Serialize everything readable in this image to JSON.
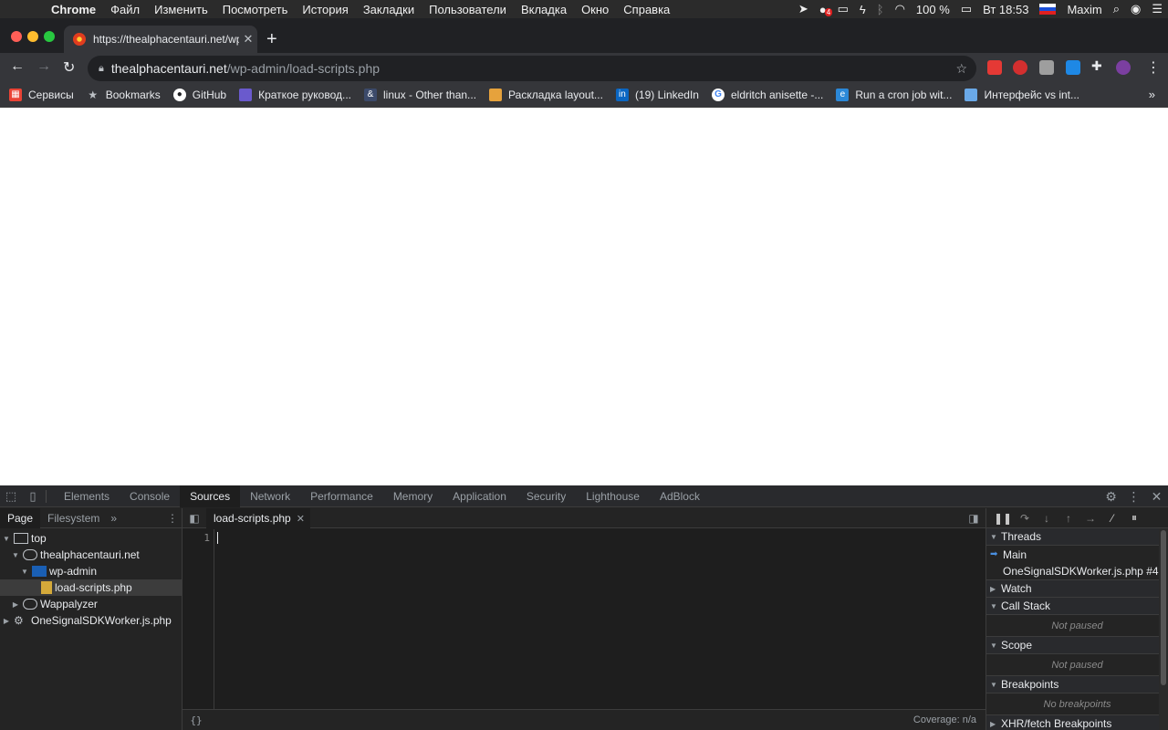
{
  "menubar": {
    "app_name": "Chrome",
    "items": [
      "Файл",
      "Изменить",
      "Посмотреть",
      "История",
      "Закладки",
      "Пользователи",
      "Вкладка",
      "Окно",
      "Справка"
    ],
    "battery": "100 %",
    "clock": "Вт 18:53",
    "user": "Maxim",
    "notification_count": "4"
  },
  "browser": {
    "tab_title": "https://thealphacentauri.net/wp-",
    "url_host": "thealphacentauri.net",
    "url_path": "/wp-admin/load-scripts.php",
    "new_tab_label": "+",
    "bookmarks": [
      {
        "label": "Сервисы",
        "icon": "apps-grid-icon",
        "color": "#ea4335"
      },
      {
        "label": "Bookmarks",
        "icon": "star-icon",
        "color": "#bdc1c6"
      },
      {
        "label": "GitHub",
        "icon": "github-icon",
        "color": "#ffffff"
      },
      {
        "label": "Краткое руковод...",
        "icon": "avatar-icon",
        "color": "#6a5acd"
      },
      {
        "label": "linux - Other than...",
        "icon": "ampersand-icon",
        "color": "#3c4a6a"
      },
      {
        "label": "Раскладка layout...",
        "icon": "keyboard-icon",
        "color": "#e6a23c"
      },
      {
        "label": "(19) LinkedIn",
        "icon": "linkedin-icon",
        "color": "#0a66c2"
      },
      {
        "label": "eldritch anisette -...",
        "icon": "google-icon",
        "color": "#ffffff"
      },
      {
        "label": "Run a cron job wit...",
        "icon": "edge-icon",
        "color": "#2b88d8"
      },
      {
        "label": "Интерфейс vs int...",
        "icon": "image-icon",
        "color": "#6aa9e8"
      }
    ],
    "bookmarks_more": "»"
  },
  "devtools": {
    "tabs": [
      "Elements",
      "Console",
      "Sources",
      "Network",
      "Performance",
      "Memory",
      "Application",
      "Security",
      "Lighthouse",
      "AdBlock"
    ],
    "active_tab": "Sources",
    "navigator": {
      "tabs": [
        "Page",
        "Filesystem"
      ],
      "active_tab": "Page",
      "more": "»",
      "tree": [
        {
          "label": "top",
          "depth": 0,
          "expanded": true,
          "icon": "frame-icon"
        },
        {
          "label": "thealphacentauri.net",
          "depth": 1,
          "expanded": true,
          "icon": "cloud-icon"
        },
        {
          "label": "wp-admin",
          "depth": 2,
          "expanded": true,
          "icon": "folder-icon"
        },
        {
          "label": "load-scripts.php",
          "depth": 3,
          "expanded": null,
          "icon": "file-icon",
          "selected": true
        },
        {
          "label": "Wappalyzer",
          "depth": 1,
          "expanded": false,
          "icon": "cloud-icon"
        },
        {
          "label": "OneSignalSDKWorker.js.php",
          "depth": 0,
          "expanded": false,
          "icon": "gear-icon"
        }
      ]
    },
    "editor": {
      "file_tab": "load-scripts.php",
      "line_numbers": [
        "1"
      ],
      "format_label": "{}",
      "coverage": "Coverage: n/a"
    },
    "debugger": {
      "sections": [
        {
          "title": "Threads",
          "expanded": true,
          "rows": [
            "Main",
            "OneSignalSDKWorker.js.php #4..."
          ],
          "empty": ""
        },
        {
          "title": "Watch",
          "expanded": false,
          "rows": [],
          "empty": ""
        },
        {
          "title": "Call Stack",
          "expanded": true,
          "rows": [],
          "empty": "Not paused"
        },
        {
          "title": "Scope",
          "expanded": true,
          "rows": [],
          "empty": "Not paused"
        },
        {
          "title": "Breakpoints",
          "expanded": true,
          "rows": [],
          "empty": "No breakpoints"
        },
        {
          "title": "XHR/fetch Breakpoints",
          "expanded": false,
          "rows": [],
          "empty": ""
        }
      ]
    }
  }
}
